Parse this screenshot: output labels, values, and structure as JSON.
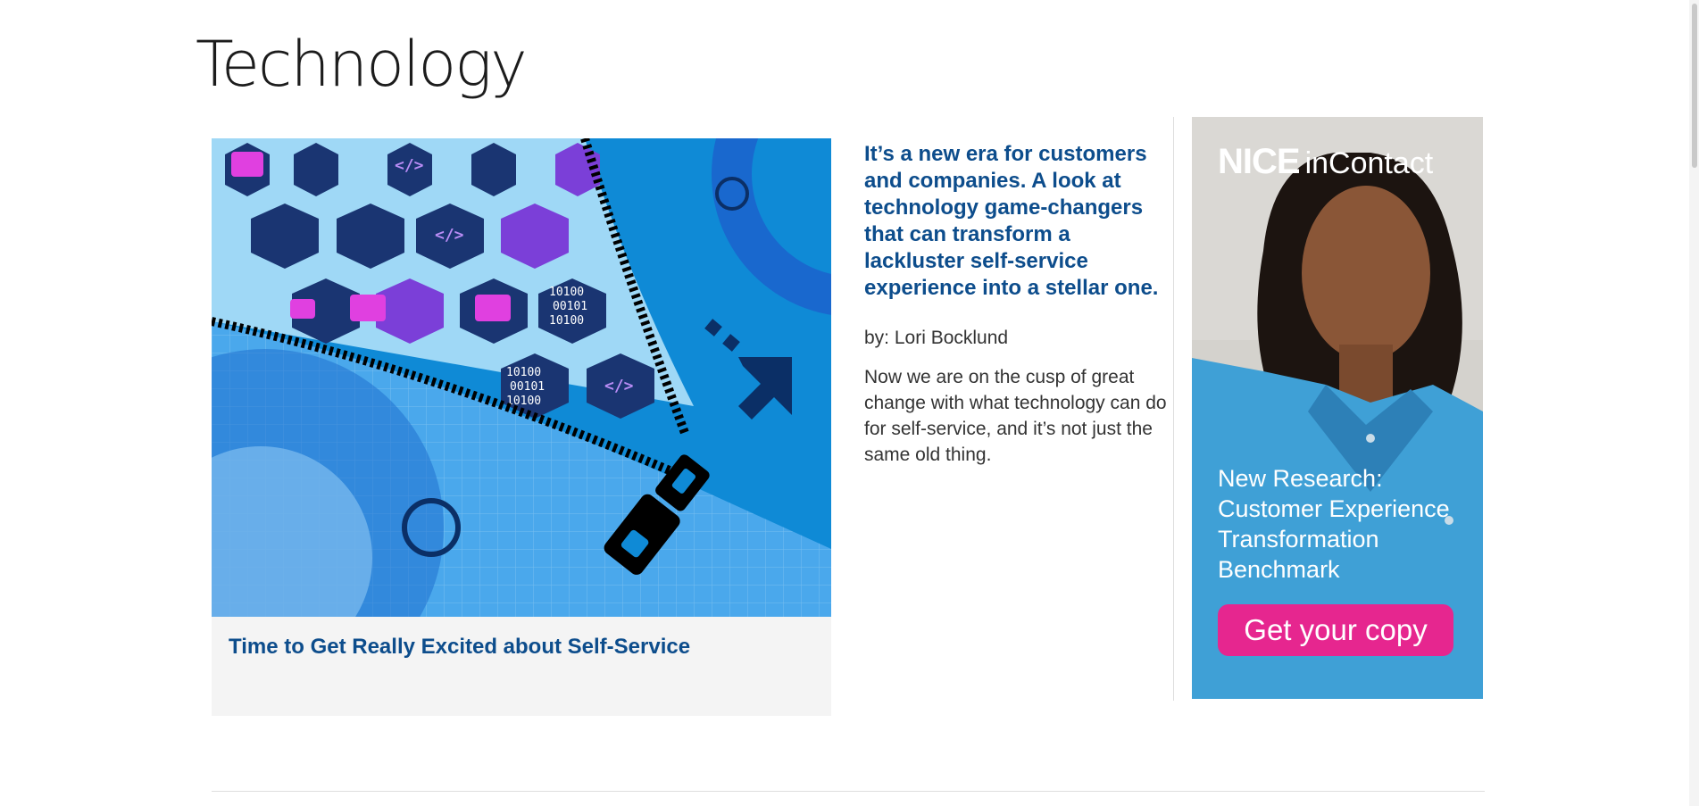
{
  "section": {
    "title": "Technology"
  },
  "featured": {
    "title": "Time to Get Really Excited about Self-Service",
    "image_alt": "zipper-illustration"
  },
  "article": {
    "teaser": "It’s a new era for customers and companies. A look at technology game-changers that can transform a lackluster self-service experience into a stellar one.",
    "byline": "by: Lori Bocklund",
    "summary": "Now we are on the cusp of great change with what technology can do for self-service, and it’s not just the same old thing."
  },
  "ad": {
    "brand": "NICE",
    "brand_suffix": "inContact",
    "headline": "New Research: Customer Experience Transformation Benchmark",
    "cta": "Get your copy",
    "cta_color": "#e6268f"
  },
  "colors": {
    "link": "#0d4d8c",
    "card_bg": "#f4f4f4"
  }
}
